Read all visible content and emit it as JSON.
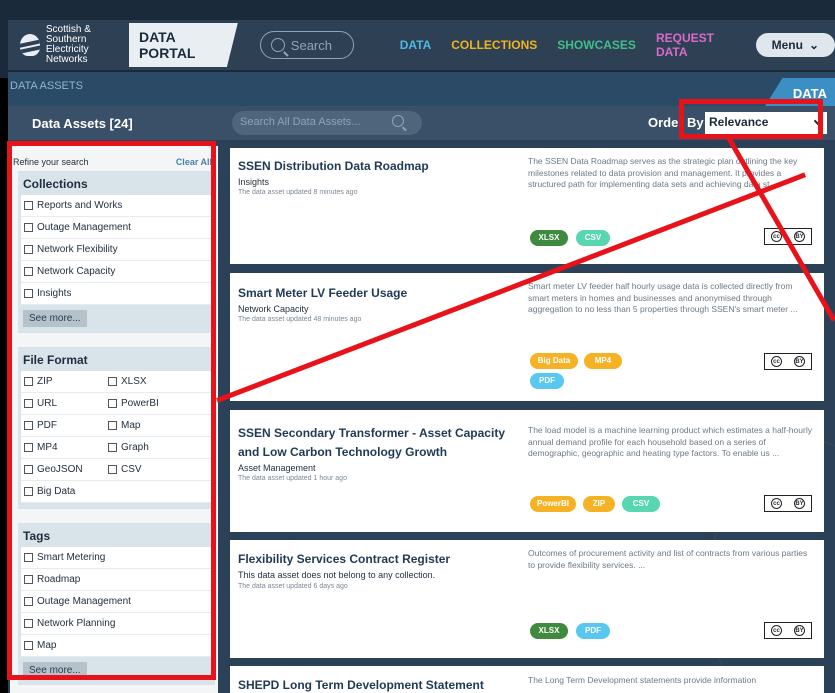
{
  "header": {
    "logo_line1": "Scottish & Southern",
    "logo_line2": "Electricity Networks",
    "portal": "DATA PORTAL",
    "search_placeholder": "Search",
    "nav": [
      "DATA",
      "COLLECTIONS",
      "SHOWCASES",
      "REQUEST DATA"
    ],
    "menu": "Menu",
    "nav_colors": {
      "data": "#4fb8e0",
      "collections": "#f0b41e",
      "showcases": "#3fbf8a",
      "request": "#d86ac8"
    }
  },
  "subheader": {
    "breadcrumb": "DATA ASSETS",
    "tab": "DATA",
    "count_label": "Data Assets [24]",
    "search_placeholder": "Search All Data Assets...",
    "order_label": "Order By",
    "order_value": "Relevance"
  },
  "sidebar": {
    "refine": "Refine your search",
    "clear_all": "Clear All",
    "collections": {
      "title": "Collections",
      "items": [
        "Reports and Works",
        "Outage Management",
        "Network Flexibility",
        "Network Capacity",
        "Insights"
      ],
      "see_more": "See more..."
    },
    "file_format": {
      "title": "File Format",
      "left": [
        "ZIP",
        "URL",
        "PDF",
        "MP4",
        "GeoJSON",
        "Big Data"
      ],
      "right": [
        "XLSX",
        "PowerBI",
        "Map",
        "Graph",
        "CSV"
      ]
    },
    "tags": {
      "title": "Tags",
      "items": [
        "Smart Metering",
        "Roadmap",
        "Outage Management",
        "Network Planning",
        "Map"
      ],
      "see_more": "See more..."
    }
  },
  "assets": [
    {
      "title": "SSEN Distribution Data Roadmap",
      "collection": "Insights",
      "updated": "The data asset updated 8 minutes ago",
      "description": "The SSEN Data Roadmap serves as the strategic plan outlining the key milestones related to data provision and management. It provides a structured path for implementing data sets and achieving data st...",
      "tags": [
        "XLSX",
        "CSV"
      ]
    },
    {
      "title": "Smart Meter LV Feeder Usage",
      "collection": "Network Capacity",
      "updated": "The data asset updated 48 minutes ago",
      "description": "Smart meter LV feeder half hourly usage data is collected directly from smart meters in homes and businesses and anonymised through aggregation to no less than 5 properties through SSEN's smart meter ...",
      "tags": [
        "Big Data",
        "MP4",
        "PDF"
      ]
    },
    {
      "title_line1": "SSEN Secondary Transformer - Asset Capacity",
      "title_line2": "and Low Carbon Technology Growth",
      "collection": "Asset Management",
      "updated": "The data asset updated 1 hour ago",
      "description": "The load model is a machine learning product which estimates a half-hourly annual demand profile for each household based on a series of demographic, geographic and heating type factors. To enable us ...",
      "tags": [
        "PowerBI",
        "ZIP",
        "CSV"
      ]
    },
    {
      "title": "Flexibility Services Contract Register",
      "collection": "This data asset does not belong to any collection.",
      "updated": "The data asset updated 6 days ago",
      "description": "Outcomes of procurement activity and list of contracts from various parties to provide flexibility services. ...",
      "tags": [
        "XLSX",
        "PDF"
      ]
    },
    {
      "title": "SHEPD Long Term Development Statement",
      "description": "The Long Term Development statements provide information"
    }
  ],
  "license": {
    "cc": "cc",
    "by": "BY"
  },
  "annotation_color": "#e8121a"
}
